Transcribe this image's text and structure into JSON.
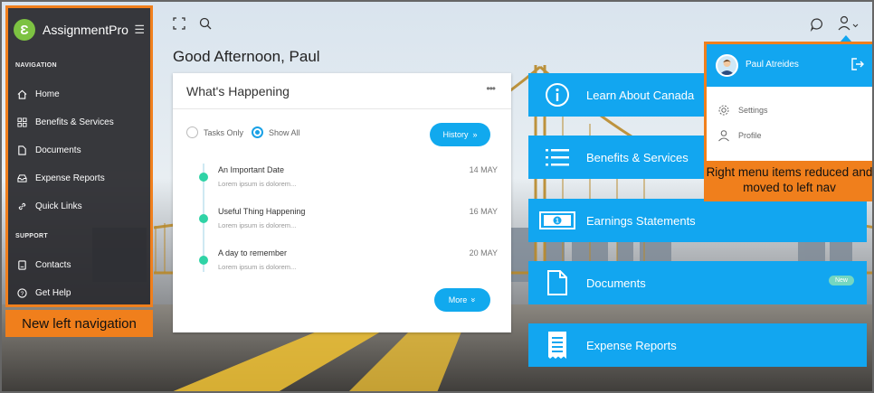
{
  "app": {
    "name": "AssignmentPro"
  },
  "sidebar": {
    "navigation_heading": "NAVIGATION",
    "items": [
      {
        "label": "Home",
        "icon": "home-icon"
      },
      {
        "label": "Benefits & Services",
        "icon": "grid-icon"
      },
      {
        "label": "Documents",
        "icon": "document-icon"
      },
      {
        "label": "Expense Reports",
        "icon": "inbox-icon"
      },
      {
        "label": "Quick Links",
        "icon": "link-icon"
      }
    ],
    "support_heading": "SUPPORT",
    "support_items": [
      {
        "label": "Contacts",
        "icon": "contacts-icon"
      },
      {
        "label": "Get Help",
        "icon": "help-icon"
      }
    ]
  },
  "annotations": {
    "left": "New left navigation",
    "right": "Right menu items reduced and moved to left nav"
  },
  "greeting": "Good Afternoon, Paul",
  "happening": {
    "title": "What's Happening",
    "filter_tasks_only": "Tasks Only",
    "filter_show_all": "Show All",
    "history_button": "History",
    "more_button": "More",
    "events": [
      {
        "title": "An Important Date",
        "desc": "Lorem ipsum is dolorem...",
        "date": "14 MAY"
      },
      {
        "title": "Useful Thing Happening",
        "desc": "Lorem ipsum is dolorem...",
        "date": "16 MAY"
      },
      {
        "title": "A day to remember",
        "desc": "Lorem ipsum is dolorem...",
        "date": "20 MAY"
      }
    ]
  },
  "tiles": [
    {
      "label": "Learn About Canada",
      "icon": "info-icon"
    },
    {
      "label": "Benefits & Services",
      "icon": "list-icon"
    },
    {
      "label": "Earnings Statements",
      "icon": "money-icon"
    },
    {
      "label": "Documents",
      "icon": "document-icon",
      "badge": "New"
    },
    {
      "label": "Expense Reports",
      "icon": "receipt-icon"
    }
  ],
  "user_menu": {
    "name": "Paul Atreides",
    "items": [
      {
        "label": "Settings",
        "icon": "gear-icon"
      },
      {
        "label": "Profile",
        "icon": "user-icon"
      }
    ]
  },
  "colors": {
    "accent": "#12a6f0",
    "annotation": "#f07f1c",
    "timeline": "#2fd3a6",
    "brand": "#7dc242"
  }
}
